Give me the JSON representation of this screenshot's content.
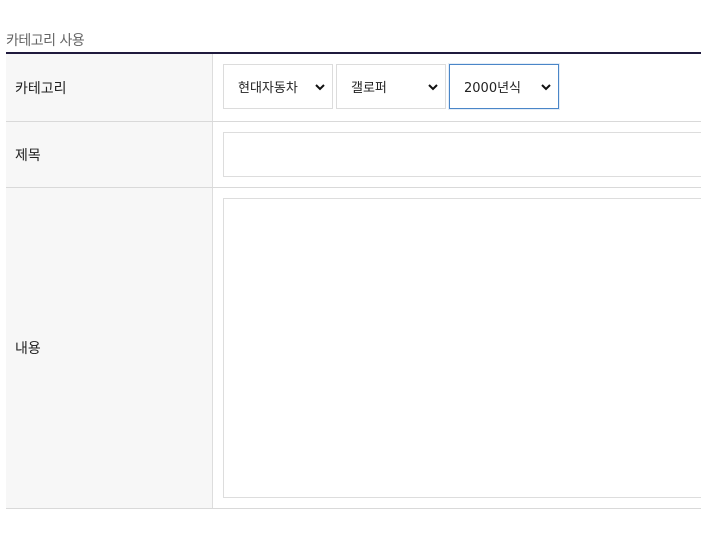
{
  "section": {
    "title": "카테고리 사용"
  },
  "form": {
    "category": {
      "label": "카테고리",
      "brand": {
        "selected": "현대자동차"
      },
      "model": {
        "selected": "갤로퍼"
      },
      "year": {
        "selected": "2000년식"
      }
    },
    "subject": {
      "label": "제목",
      "value": ""
    },
    "content": {
      "label": "내용",
      "value": ""
    }
  },
  "icons": {
    "select_arrow": "chevron-down-icon"
  },
  "colors": {
    "header_rule": "#1f1a3d",
    "label_background": "#f7f7f7",
    "focus_border": "#4a86c8"
  }
}
